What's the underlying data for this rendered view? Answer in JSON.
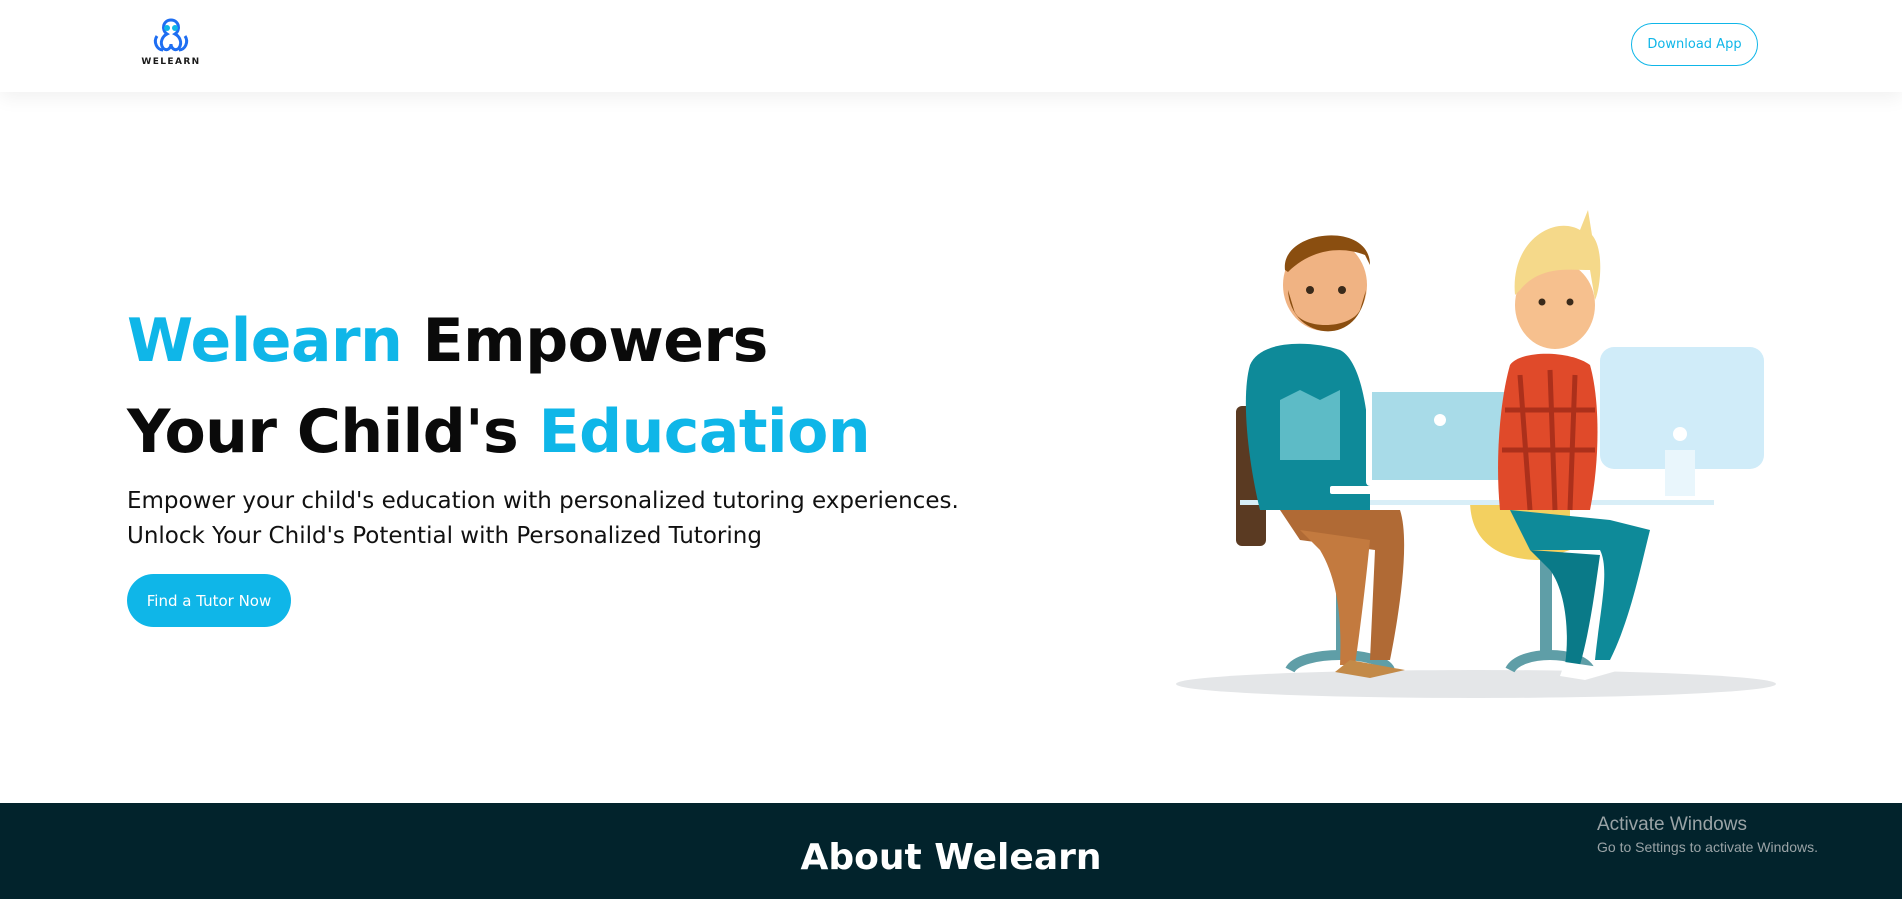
{
  "header": {
    "logo_text": "WELEARN",
    "download_button": "Download App"
  },
  "hero": {
    "title_line1_accent": "Welearn",
    "title_line1_rest": " Empowers",
    "title_line2_start": "Your Child's ",
    "title_line2_accent": "Education",
    "subtitle_line1": "Empower your child's education with personalized tutoring experiences.",
    "subtitle_line2": "Unlock Your Child's Potential with Personalized Tutoring",
    "cta_button": "Find a Tutor Now"
  },
  "about": {
    "title": "About Welearn"
  },
  "watermark": {
    "title": "Activate Windows",
    "subtitle": "Go to Settings to activate Windows."
  },
  "colors": {
    "accent": "#0fb6e8",
    "dark_section": "#02232c"
  },
  "icons": {
    "logo": "welearn-logo-icon"
  }
}
